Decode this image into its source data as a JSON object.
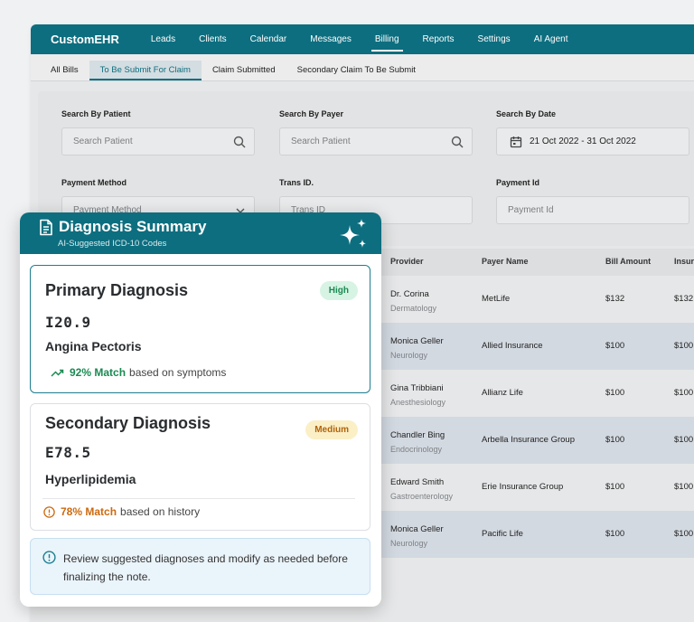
{
  "app": {
    "brand": "CustomEHR",
    "nav": [
      "Leads",
      "Clients",
      "Calendar",
      "Messages",
      "Billing",
      "Reports",
      "Settings",
      "AI Agent"
    ],
    "nav_active": "Billing",
    "subtabs": [
      "All Bills",
      "To Be Submit For Claim",
      "Claim Submitted",
      "Secondary Claim To Be Submit"
    ],
    "subtab_active": "To Be Submit For Claim"
  },
  "filters": {
    "patient_label": "Search By Patient",
    "patient_placeholder": "Search Patient",
    "payer_label": "Search By Payer",
    "payer_placeholder": "Search Patient",
    "date_label": "Search By Date",
    "date_value": "21 Oct 2022 - 31 Oct 2022",
    "method_label": "Payment Method",
    "method_placeholder": "Payment Method",
    "trans_label": "Trans ID.",
    "trans_placeholder": "Trans ID",
    "payid_label": "Payment Id",
    "payid_placeholder": "Payment Id"
  },
  "table": {
    "headers": {
      "provider": "Provider",
      "payer": "Payer Name",
      "amount": "Bill Amount",
      "insurance": "Insur"
    },
    "rows": [
      {
        "provider": "Dr. Corina",
        "specialty": "Dermatology",
        "payer": "MetLife",
        "amount": "$132",
        "insurance": "$132"
      },
      {
        "provider": "Monica Geller",
        "specialty": "Neurology",
        "payer": "Allied Insurance",
        "amount": "$100",
        "insurance": "$100"
      },
      {
        "provider": "Gina Tribbiani",
        "specialty": "Anesthesiology",
        "payer": "Allianz Life",
        "amount": "$100",
        "insurance": "$100"
      },
      {
        "provider": "Chandler Bing",
        "specialty": "Endocrinology",
        "payer": "Arbella Insurance Group",
        "amount": "$100",
        "insurance": "$100"
      },
      {
        "provider": "Edward Smith",
        "specialty": "Gastroenterology",
        "payer": "Erie Insurance Group",
        "amount": "$100",
        "insurance": "$100"
      },
      {
        "provider": "Monica Geller",
        "specialty": "Neurology",
        "payer": "Pacific Life",
        "amount": "$100",
        "insurance": "$100"
      }
    ]
  },
  "summary": {
    "title": "Diagnosis Summary",
    "subtitle": "AI-Suggested ICD-10 Codes",
    "primary": {
      "heading": "Primary Diagnosis",
      "code": "I20.9",
      "name": "Angina Pectoris",
      "badge": "High",
      "match_pct": "92% Match",
      "match_text": "based on symptoms"
    },
    "secondary": {
      "heading": "Secondary Diagnosis",
      "code": "E78.5",
      "name": "Hyperlipidemia",
      "badge": "Medium",
      "match_pct": "78% Match",
      "match_text": "based on history"
    },
    "note": "Review suggested diagnoses and modify as needed before finalizing the note."
  },
  "colors": {
    "brand": "#0d6e7f",
    "high": "#1a8a52",
    "medium": "#cc6a10",
    "note_bg": "#eaf4fb"
  }
}
